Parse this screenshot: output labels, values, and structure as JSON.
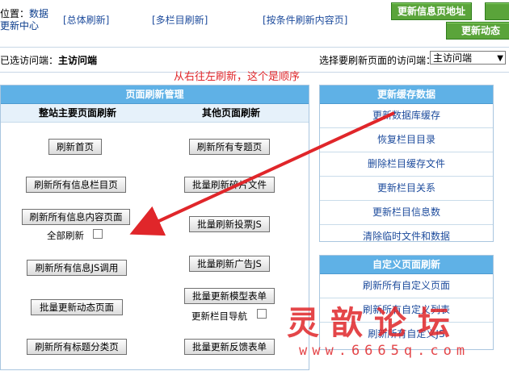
{
  "header": {
    "location_label": "位置：",
    "location_link": "数据",
    "location_line2": "更新中心",
    "links": [
      "[总体刷新]",
      "[多栏目刷新]",
      "[按条件刷新内容页]"
    ],
    "btn_update_info": "更新信息页地址",
    "btn_update_dynamic": "更新动态"
  },
  "visit": {
    "selected_label": "已选访问端：",
    "selected_value": "主访问端",
    "choose_label": "选择要刷新页面的访问端：",
    "choose_value": "主访问端"
  },
  "annotation": "从右往左刷新，这个是顺序",
  "left_panel": {
    "title": "页面刷新管理",
    "col1_title": "整站主要页面刷新",
    "col2_title": "其他页面刷新",
    "col1": [
      "刷新首页",
      "刷新所有信息栏目页",
      "刷新所有信息内容页面",
      "刷新所有信息JS调用",
      "批量更新动态页面",
      "刷新所有标题分类页"
    ],
    "full_refresh_label": "全部刷新",
    "col2": [
      "刷新所有专题页",
      "批量刷新碎片文件",
      "批量刷新投票JS",
      "批量刷新广告JS",
      "批量更新模型表单",
      "批量更新反馈表单"
    ],
    "nav_update_label": "更新栏目导航"
  },
  "cache_panel": {
    "title": "更新缓存数据",
    "items": [
      "更新数据库缓存",
      "恢复栏目目录",
      "删除栏目缓存文件",
      "更新栏目关系",
      "更新栏目信息数",
      "清除临时文件和数据"
    ]
  },
  "custom_panel": {
    "title": "自定义页面刷新",
    "items": [
      "刷新所有自定义页面",
      "刷新所有自定义列表",
      "刷新所有自定义JS"
    ]
  },
  "watermark": {
    "text": "灵歆论坛",
    "url": "www.6665q.com"
  },
  "colors": {
    "header_blue": "#5fb1e6",
    "accent_red": "#e0262a",
    "green_button": "#5aa43a",
    "link_blue": "#1d4b9c"
  }
}
